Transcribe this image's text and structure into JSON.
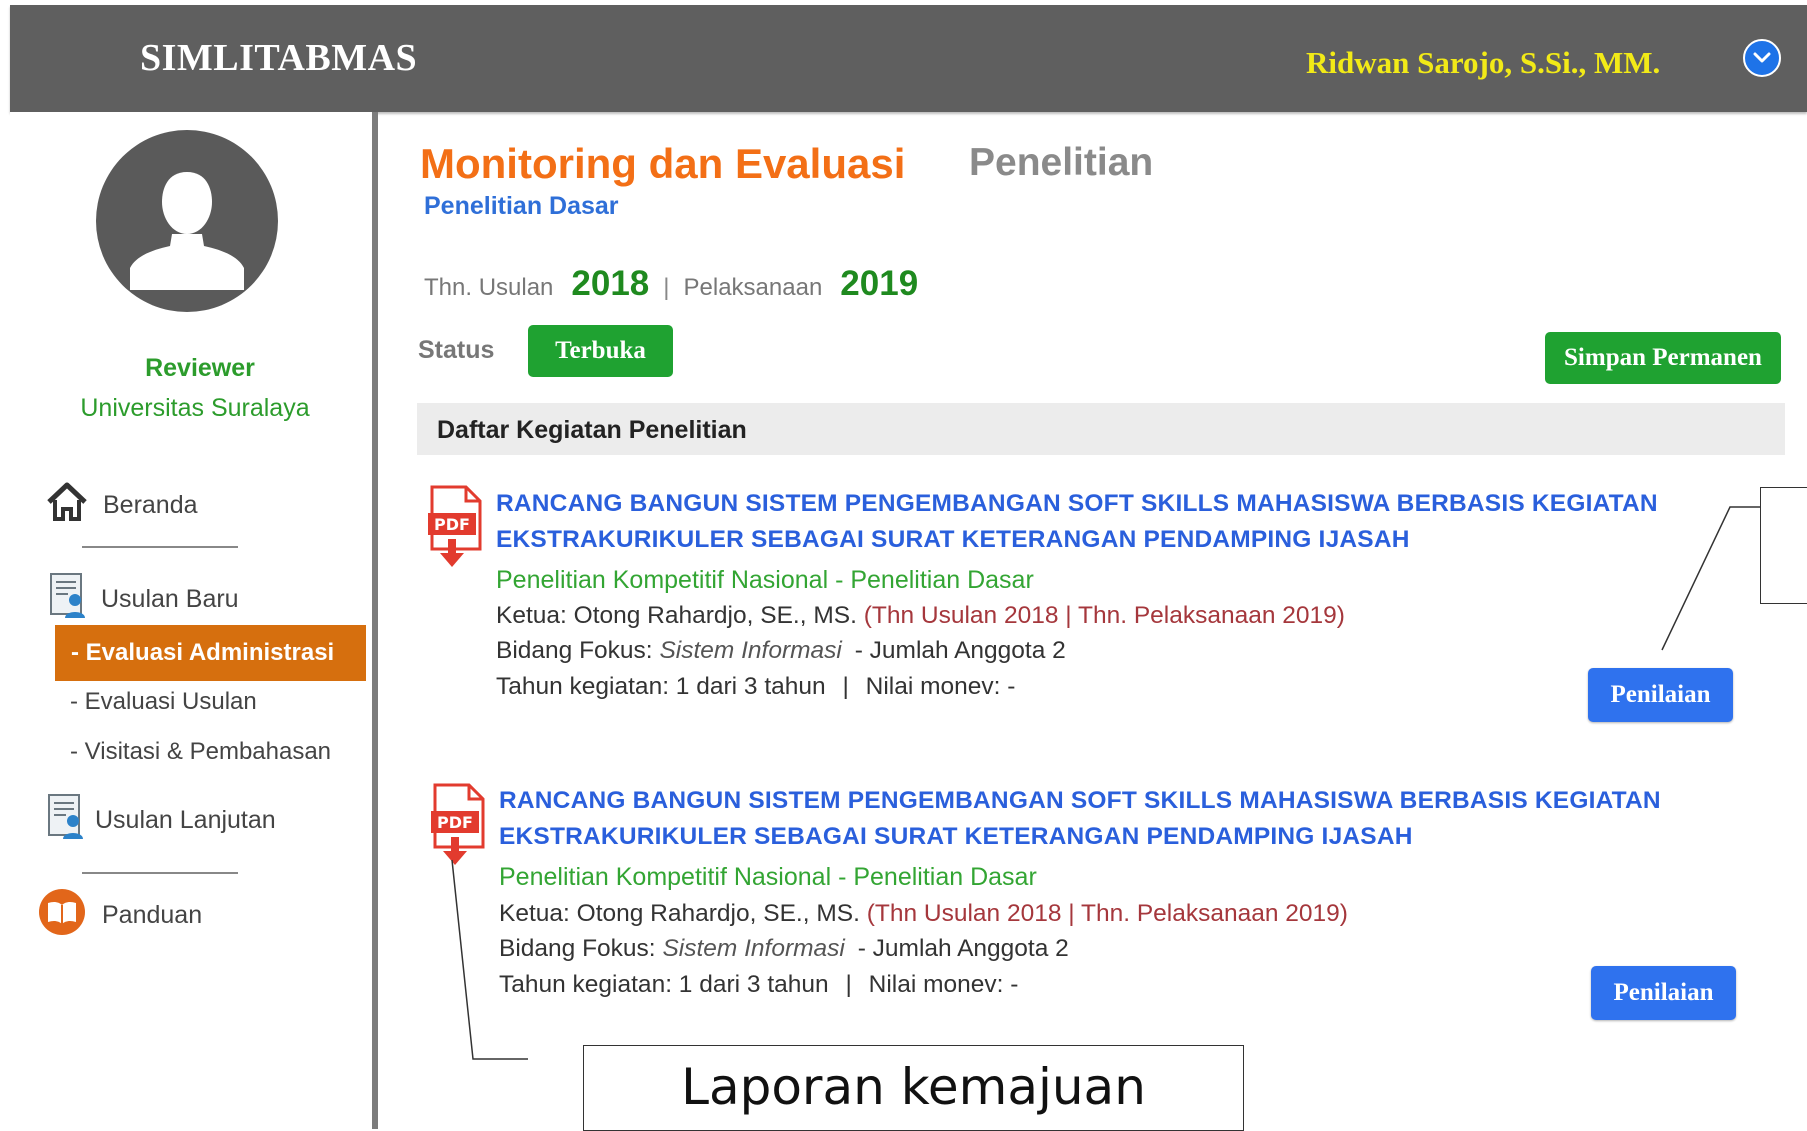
{
  "header": {
    "brand": "SIMLITABMAS",
    "user_name": "Ridwan Sarojo, S.Si., MM.",
    "user_menu_icon": "chevron-down-circle-icon"
  },
  "sidebar": {
    "role": "Reviewer",
    "institution": "Universitas Suralaya",
    "nav": {
      "beranda": "Beranda",
      "usulan_baru": "Usulan Baru",
      "evaluasi_administrasi": "- Evaluasi Administrasi",
      "evaluasi_usulan": "- Evaluasi Usulan",
      "visitasi": "- Visitasi & Pembahasan",
      "usulan_lanjutan": "Usulan Lanjutan",
      "panduan": "Panduan"
    }
  },
  "page": {
    "title": "Monitoring dan Evaluasi",
    "subtitle": "Penelitian",
    "breadcrumb": "Penelitian Dasar",
    "thn_usulan_label": "Thn. Usulan",
    "thn_usulan": "2018",
    "separator": "|",
    "pelaksanaan_label": "Pelaksanaan",
    "pelaksanaan": "2019",
    "status_label": "Status",
    "status_value": "Terbuka",
    "save_button": "Simpan Permanen",
    "list_header": "Daftar Kegiatan Penelitian"
  },
  "items": [
    {
      "title_line1": "RANCANG BANGUN SISTEM PENGEMBANGAN SOFT SKILLS MAHASISWA BERBASIS KEGIATAN",
      "title_line2": "EKSTRAKURIKULER SEBAGAI SURAT KETERANGAN PENDAMPING IJASAH",
      "scheme": "Penelitian Kompetitif Nasional - Penelitian Dasar",
      "ketua": "Ketua: Otong Rahardjo, SE., MS.",
      "years": "(Thn Usulan 2018 | Thn. Pelaksanaan 2019)",
      "bidang_label": "Bidang Fokus:",
      "bidang_value": "Sistem Informasi",
      "anggota": "- Jumlah Anggota 2",
      "tahun_kegiatan": "Tahun kegiatan: 1 dari 3 tahun",
      "nilai_monev": "Nilai monev: -",
      "button": "Penilaian"
    },
    {
      "title_line1": "RANCANG BANGUN SISTEM PENGEMBANGAN SOFT SKILLS MAHASISWA BERBASIS KEGIATAN",
      "title_line2": "EKSTRAKURIKULER SEBAGAI SURAT KETERANGAN PENDAMPING IJASAH",
      "scheme": "Penelitian Kompetitif Nasional - Penelitian Dasar",
      "ketua": "Ketua: Otong Rahardjo, SE., MS.",
      "years": "(Thn Usulan 2018 | Thn. Pelaksanaan 2019)",
      "bidang_label": "Bidang Fokus:",
      "bidang_value": "Sistem Informasi",
      "anggota": "- Jumlah Anggota 2",
      "tahun_kegiatan": "Tahun kegiatan: 1 dari 3  tahun",
      "nilai_monev": "Nilai monev: -",
      "button": "Penilaian"
    }
  ],
  "pdf_icon_text": "PDF",
  "callout": {
    "laporan": "Laporan kemajuan"
  }
}
